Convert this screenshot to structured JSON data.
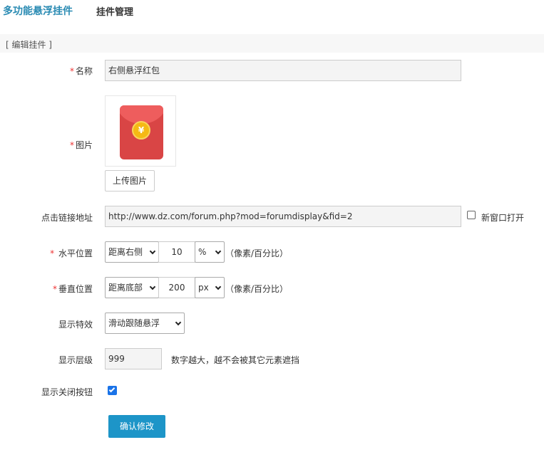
{
  "nav": {
    "active_tab": "多功能悬浮挂件",
    "other_tab": "挂件管理"
  },
  "section": {
    "title": "[ 编辑挂件 ]"
  },
  "form": {
    "required_mark": "*",
    "name": {
      "label": "名称",
      "value": "右侧悬浮红包"
    },
    "image": {
      "label": "图片",
      "icon": "red-envelope-icon",
      "coin_symbol": "¥",
      "upload_label": "上传图片"
    },
    "link": {
      "label": "点击链接地址",
      "value": "http://www.dz.com/forum.php?mod=forumdisplay&fid=2",
      "new_window_label": "新窗口打开",
      "new_window_checked": false
    },
    "horizontal": {
      "label": "水平位置",
      "side": "距离右侧",
      "value": "10",
      "unit": "%",
      "hint": "（像素/百分比）"
    },
    "vertical": {
      "label": "垂直位置",
      "side": "距离底部",
      "value": "200",
      "unit": "px",
      "hint": "（像素/百分比）"
    },
    "effect": {
      "label": "显示特效",
      "value": "滑动跟随悬浮"
    },
    "layer": {
      "label": "显示层级",
      "value": "999",
      "hint": "数字越大，越不会被其它元素遮挡"
    },
    "close_button": {
      "label": "显示关闭按钮",
      "checked": true
    },
    "submit_label": "确认修改"
  },
  "colors": {
    "accent": "#1d95c8",
    "nav_active": "#2a8bb3",
    "required": "#ee3333",
    "checkbox": "#1a73e8"
  }
}
